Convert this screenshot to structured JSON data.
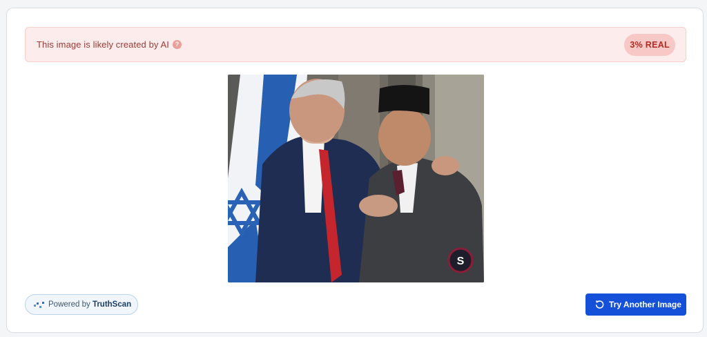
{
  "alert": {
    "message": "This image is likely created by AI",
    "help_icon": "question-circle-icon",
    "help_glyph": "?",
    "badge": "3% REAL",
    "colors": {
      "background": "#fdecec",
      "text": "#9b3b36",
      "badge_bg": "#f7c8c6",
      "badge_text": "#b12a24"
    }
  },
  "preview": {
    "watermark_letter": "S"
  },
  "footer": {
    "powered_prefix": "Powered by",
    "powered_brand": "TruthScan",
    "powered_icon": "truthscan-logo-icon",
    "try_label": "Try Another Image",
    "try_icon": "refresh-icon",
    "button_color": "#1550d8"
  }
}
